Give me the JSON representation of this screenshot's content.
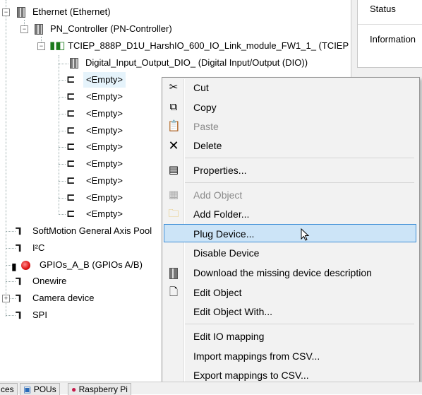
{
  "tree": {
    "items": [
      {
        "label": "Ethernet (Ethernet)"
      },
      {
        "label": "PN_Controller (PN-Controller)"
      },
      {
        "label": "TCIEP_888P_D1U_HarshIO_600_IO_Link_module_FW1_1_ (TCIEP"
      },
      {
        "label": "Digital_Input_Output_DIO_ (Digital Input/Output (DIO))"
      },
      {
        "label": "<Empty>"
      },
      {
        "label": "<Empty>"
      },
      {
        "label": "<Empty>"
      },
      {
        "label": "<Empty>"
      },
      {
        "label": "<Empty>"
      },
      {
        "label": "<Empty>"
      },
      {
        "label": "<Empty>"
      },
      {
        "label": "<Empty>"
      },
      {
        "label": "<Empty>"
      },
      {
        "label": "SoftMotion General Axis Pool"
      },
      {
        "label": "I²C"
      },
      {
        "label": "GPIOs_A_B (GPIOs A/B)"
      },
      {
        "label": "Onewire"
      },
      {
        "label": "Camera device"
      },
      {
        "label": "SPI"
      }
    ]
  },
  "right_panel": {
    "status_label": "Status",
    "information_label": "Information"
  },
  "context_menu": {
    "items": [
      {
        "label": "Cut",
        "icon": "scissors-icon",
        "enabled": true
      },
      {
        "label": "Copy",
        "icon": "copy-icon",
        "enabled": true
      },
      {
        "label": "Paste",
        "icon": "paste-icon",
        "enabled": false
      },
      {
        "label": "Delete",
        "icon": "delete-x-icon",
        "enabled": true
      },
      {
        "label": "Properties...",
        "icon": "properties-icon",
        "enabled": true
      },
      {
        "label": "Add Object",
        "icon": "add-object-icon",
        "enabled": false
      },
      {
        "label": "Add Folder...",
        "icon": "folder-icon",
        "enabled": true
      },
      {
        "label": "Plug Device...",
        "icon": "",
        "enabled": true,
        "selected": true
      },
      {
        "label": "Disable Device",
        "icon": "",
        "enabled": true
      },
      {
        "label": "Download the missing device description",
        "icon": "device-module-icon",
        "enabled": true
      },
      {
        "label": "Edit Object",
        "icon": "edit-object-icon",
        "enabled": true
      },
      {
        "label": "Edit Object With...",
        "icon": "",
        "enabled": true
      },
      {
        "label": "Edit IO mapping",
        "icon": "",
        "enabled": true
      },
      {
        "label": "Import mappings from CSV...",
        "icon": "",
        "enabled": true
      },
      {
        "label": "Export mappings to CSV...",
        "icon": "",
        "enabled": true
      }
    ]
  },
  "bottom_tabs": {
    "tab1": "ces",
    "tab2": "POUs",
    "tab3": "Raspberry Pi"
  },
  "colors": {
    "menu_bg": "#f2f2f2",
    "selection_bg": "#cce4f7",
    "selection_border": "#3d8ed6",
    "tree_highlight": "#e5f3fb"
  }
}
